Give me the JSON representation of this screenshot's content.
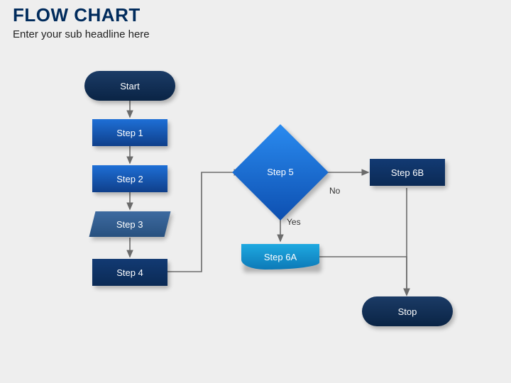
{
  "title": "FLOW CHART",
  "subtitle": "Enter your sub headline here",
  "nodes": {
    "start": "Start",
    "step1": "Step 1",
    "step2": "Step 2",
    "step3": "Step 3",
    "step4": "Step 4",
    "step5": "Step 5",
    "step6a": "Step 6A",
    "step6b": "Step 6B",
    "stop": "Stop"
  },
  "labels": {
    "yes": "Yes",
    "no": "No"
  }
}
